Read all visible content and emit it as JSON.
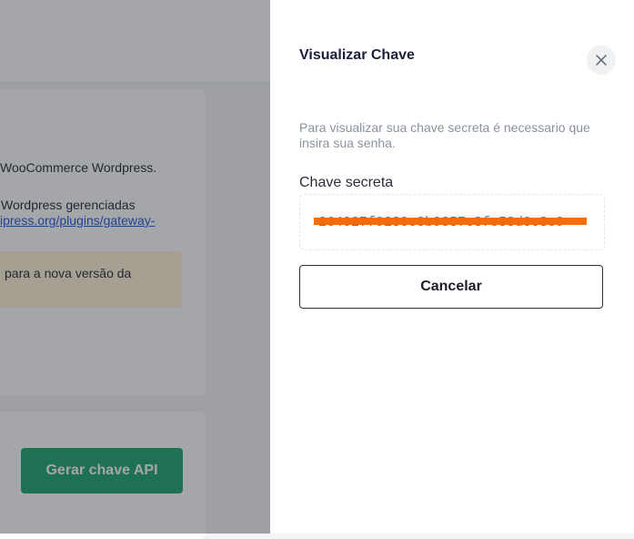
{
  "background": {
    "line1": "WooCommerce Wordpress.",
    "line2": "Wordpress gerenciadas",
    "link_text": "ipress.org/plugins/gateway-",
    "notice_text": "para a nova versão da",
    "generate_button": "Gerar chave API"
  },
  "drawer": {
    "title": "Visualizar Chave",
    "description": "Para visualizar sua chave secreta é necessario que insira sua senha.",
    "field_label": "Chave secreta",
    "key_value": "264027f9280c3b9357c8fc58d0c8c9",
    "cancel_label": "Cancelar"
  },
  "icons": {
    "close": "close-icon"
  },
  "colors": {
    "primary_green": "#17a66a",
    "redaction": "#ff6a00",
    "link": "#1a57d6",
    "notice_bg": "#fff4d6"
  }
}
